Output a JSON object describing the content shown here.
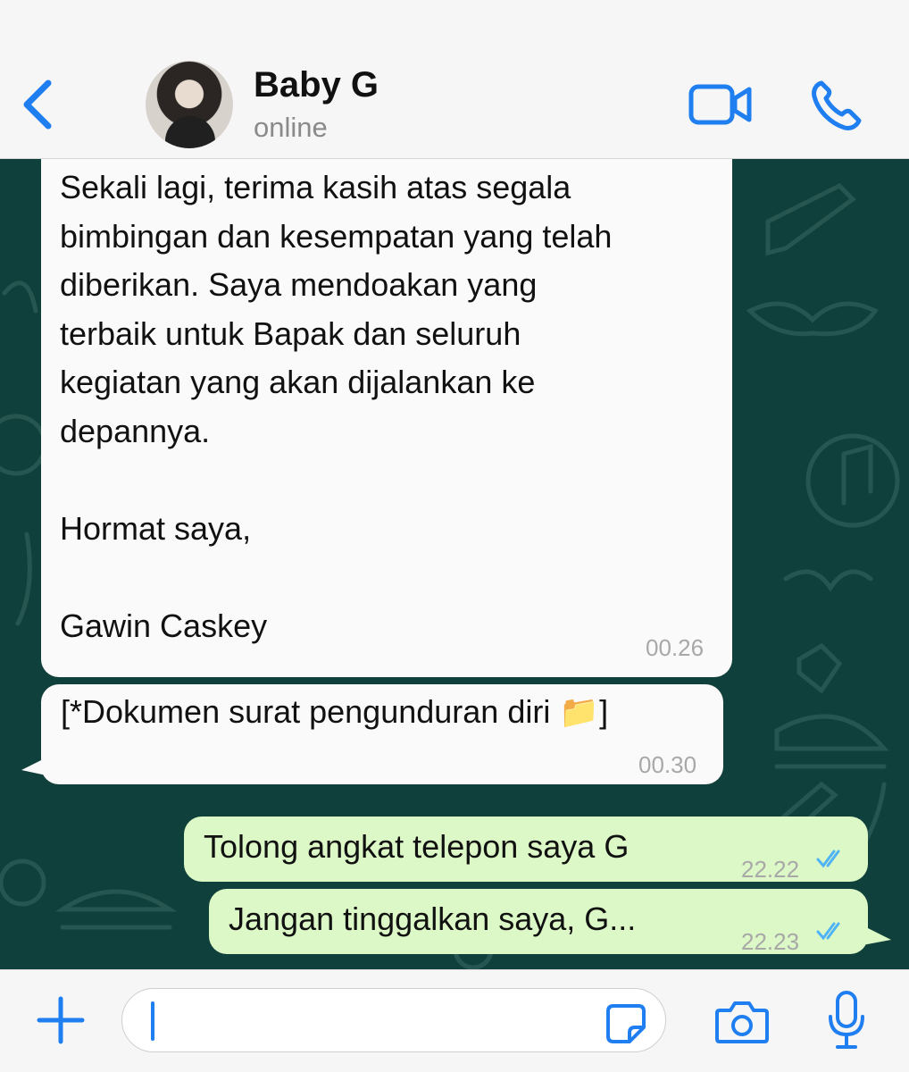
{
  "header": {
    "contact_name": "Baby G",
    "contact_status": "online",
    "icons": [
      "back-chevron-icon",
      "video-call-icon",
      "voice-call-icon"
    ],
    "accent_color": "#1f7ef0"
  },
  "messages": [
    {
      "direction": "incoming",
      "text": "Sekali lagi, terima kasih atas segala\nbimbingan dan kesempatan yang telah\ndiberikan. Saya mendoakan yang\nterbaik untuk Bapak dan seluruh\nkegiatan yang akan dijalankan ke\ndepannya.\n\nHormat saya,\n\nGawin Caskey",
      "time": "00.26"
    },
    {
      "direction": "incoming",
      "text": "[*Dokumen surat pengunduran diri 📁]",
      "time": "00.30"
    },
    {
      "direction": "outgoing",
      "text": "Tolong angkat telepon saya G",
      "time": "22.22",
      "status": "read"
    },
    {
      "direction": "outgoing",
      "text": "Jangan tinggalkan saya, G...",
      "time": "22.23",
      "status": "read"
    }
  ],
  "composer": {
    "icons": [
      "plus-icon",
      "sticker-icon",
      "camera-icon",
      "microphone-icon"
    ],
    "value": ""
  },
  "colors": {
    "incoming_bubble": "#fafafa",
    "outgoing_bubble": "#dcf8c6",
    "chat_background": "#0f403b",
    "read_check": "#4fb3f6"
  }
}
